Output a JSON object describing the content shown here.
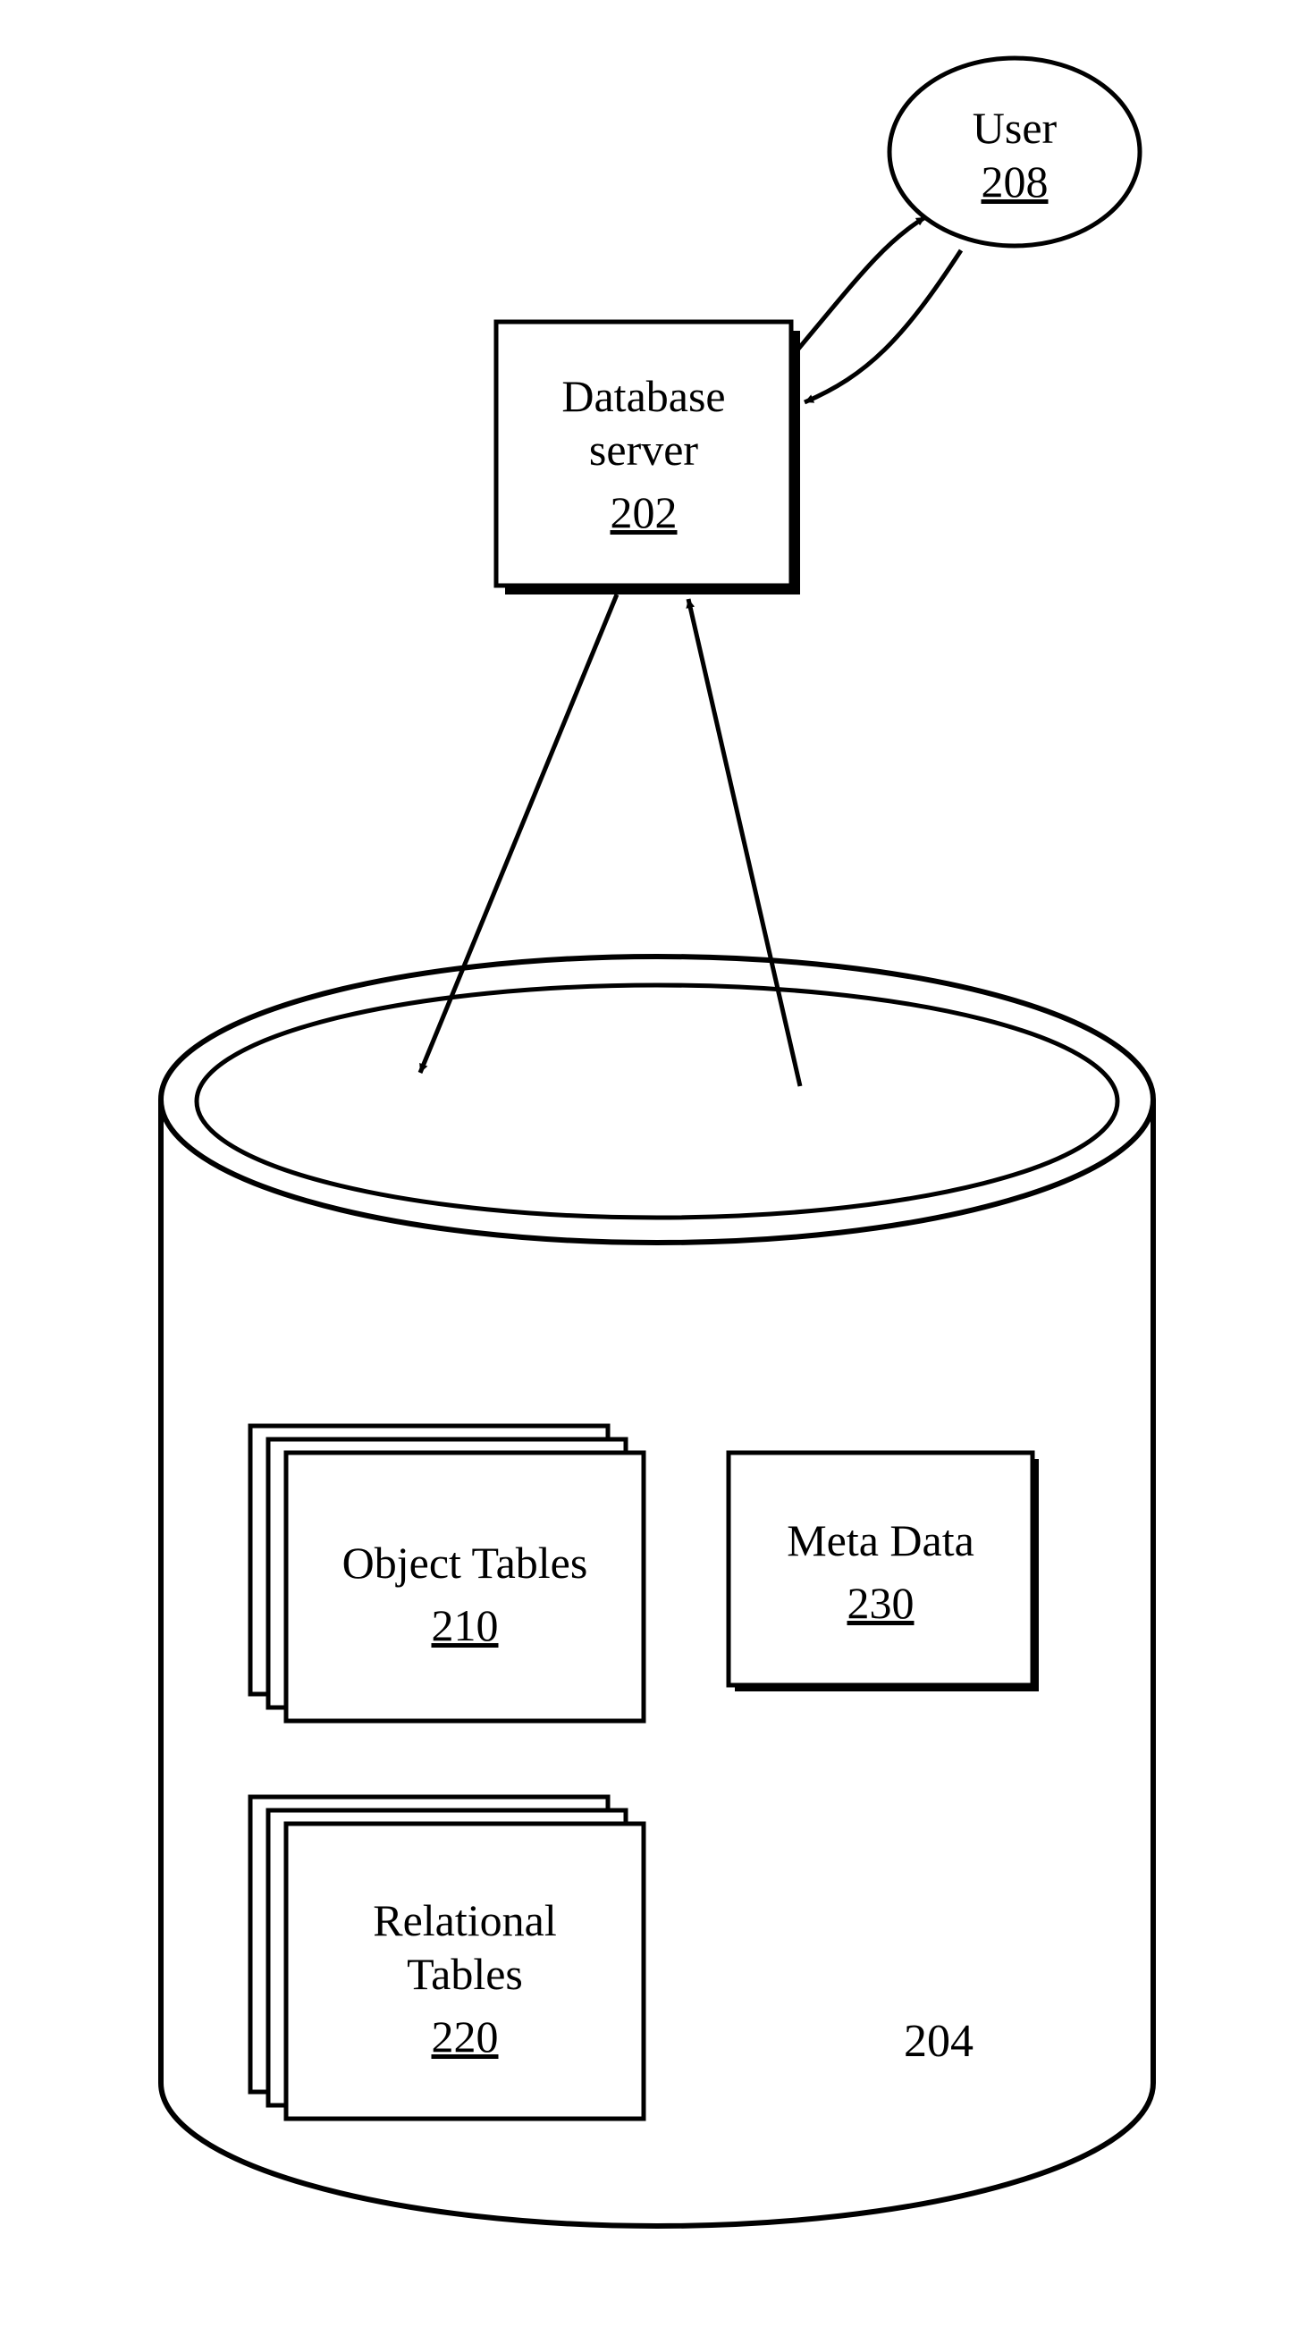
{
  "user": {
    "label": "User",
    "ref": "208"
  },
  "dbserver": {
    "label_line1": "Database",
    "label_line2": "server",
    "ref": "202"
  },
  "storage": {
    "ref": "204",
    "object_tables": {
      "label": "Object Tables",
      "ref": "210"
    },
    "relational_tables": {
      "label_line1": "Relational",
      "label_line2": "Tables",
      "ref": "220"
    },
    "meta_data": {
      "label": "Meta Data",
      "ref": "230"
    }
  }
}
